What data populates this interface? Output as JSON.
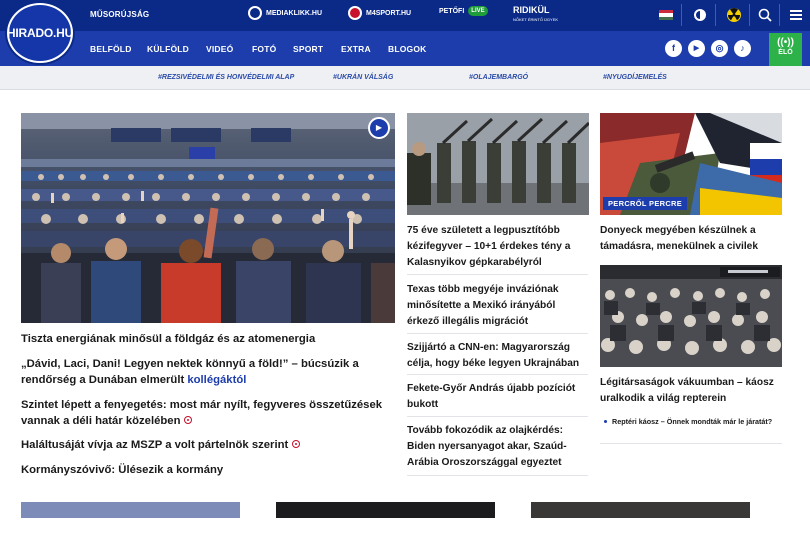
{
  "logo": {
    "text": "HIRADO.HU"
  },
  "topbar": {
    "program_link": "MŰSORÚJSÁG",
    "partners": [
      {
        "label": "MEDIAKLIKK.HU"
      },
      {
        "label": "M4SPORT.HU"
      },
      {
        "label": "PETŐFI",
        "badge": "LIVE"
      }
    ],
    "ridikul": {
      "title": "RIDIKÜL",
      "subtitle": "NŐKET ÉRINTŐ ÜGYEK"
    },
    "icons": [
      "flag-icon",
      "brightness-icon",
      "radiation-icon",
      "search-icon",
      "menu-icon"
    ],
    "colors": {
      "top": "#0b2a88",
      "nav": "#1c3dab",
      "live": "#2db24a"
    }
  },
  "nav": {
    "items": [
      "BELFÖLD",
      "KÜLFÖLD",
      "VIDEÓ",
      "FOTÓ",
      "SPORT",
      "EXTRA",
      "BLOGOK"
    ],
    "social": [
      "f",
      "▶",
      "◎",
      "♪"
    ],
    "live_label": "ÉLŐ"
  },
  "tags": [
    "#REZSIVÉDELMI ÉS HONVÉDELMI ALAP",
    "#UKRÁN VÁLSÁG",
    "#OLAJEMBARGÓ",
    "#NYUGDÍJEMELÉS"
  ],
  "lead": {
    "headlines": [
      "Tiszta energiának minősül a földgáz és az atomenergia",
      "„Dávid, Laci, Dani! Legyen nektek könnyű a föld!” – búcsúzik a rendőrség a Dunában elmerült ",
      "kollégáktól",
      "Szintet lépett a fenyegetés: most már nyílt, fegyveres összetűzések vannak a déli határ közelében",
      "Haláltusáját vívja az MSZP a volt pártelnök szerint",
      "Kormányszóvivő: Ülésezik a kormány"
    ]
  },
  "middle": {
    "items": [
      "75 éve született a legpusztítóbb kézifegyver – 10+1 érdekes tény a Kalasnyikov gépkarabélyról",
      "Texas több megyéje inváziónak minősítette a Mexikó irányából érkező illegális migrációt",
      "Szijjártó a CNN-en: Magyarország célja, hogy béke legyen Ukrajnában",
      "Fekete-Győr András újabb pozíciót bukott",
      "Tovább fokozódik az olajkérdés: Biden nyersanyagot akar, Szaúd-Arábia Oroszországgal egyeztet"
    ]
  },
  "right": {
    "badge": "PERCRŐL PERCRE",
    "items": [
      "Donyeck megyében készülnek a támadásra, menekülnek a civilek",
      "Légitársaságok vákuumban – káosz uralkodik a világ repterein"
    ],
    "sub": "Reptéri káosz – Önnek mondták már le járatát?"
  }
}
